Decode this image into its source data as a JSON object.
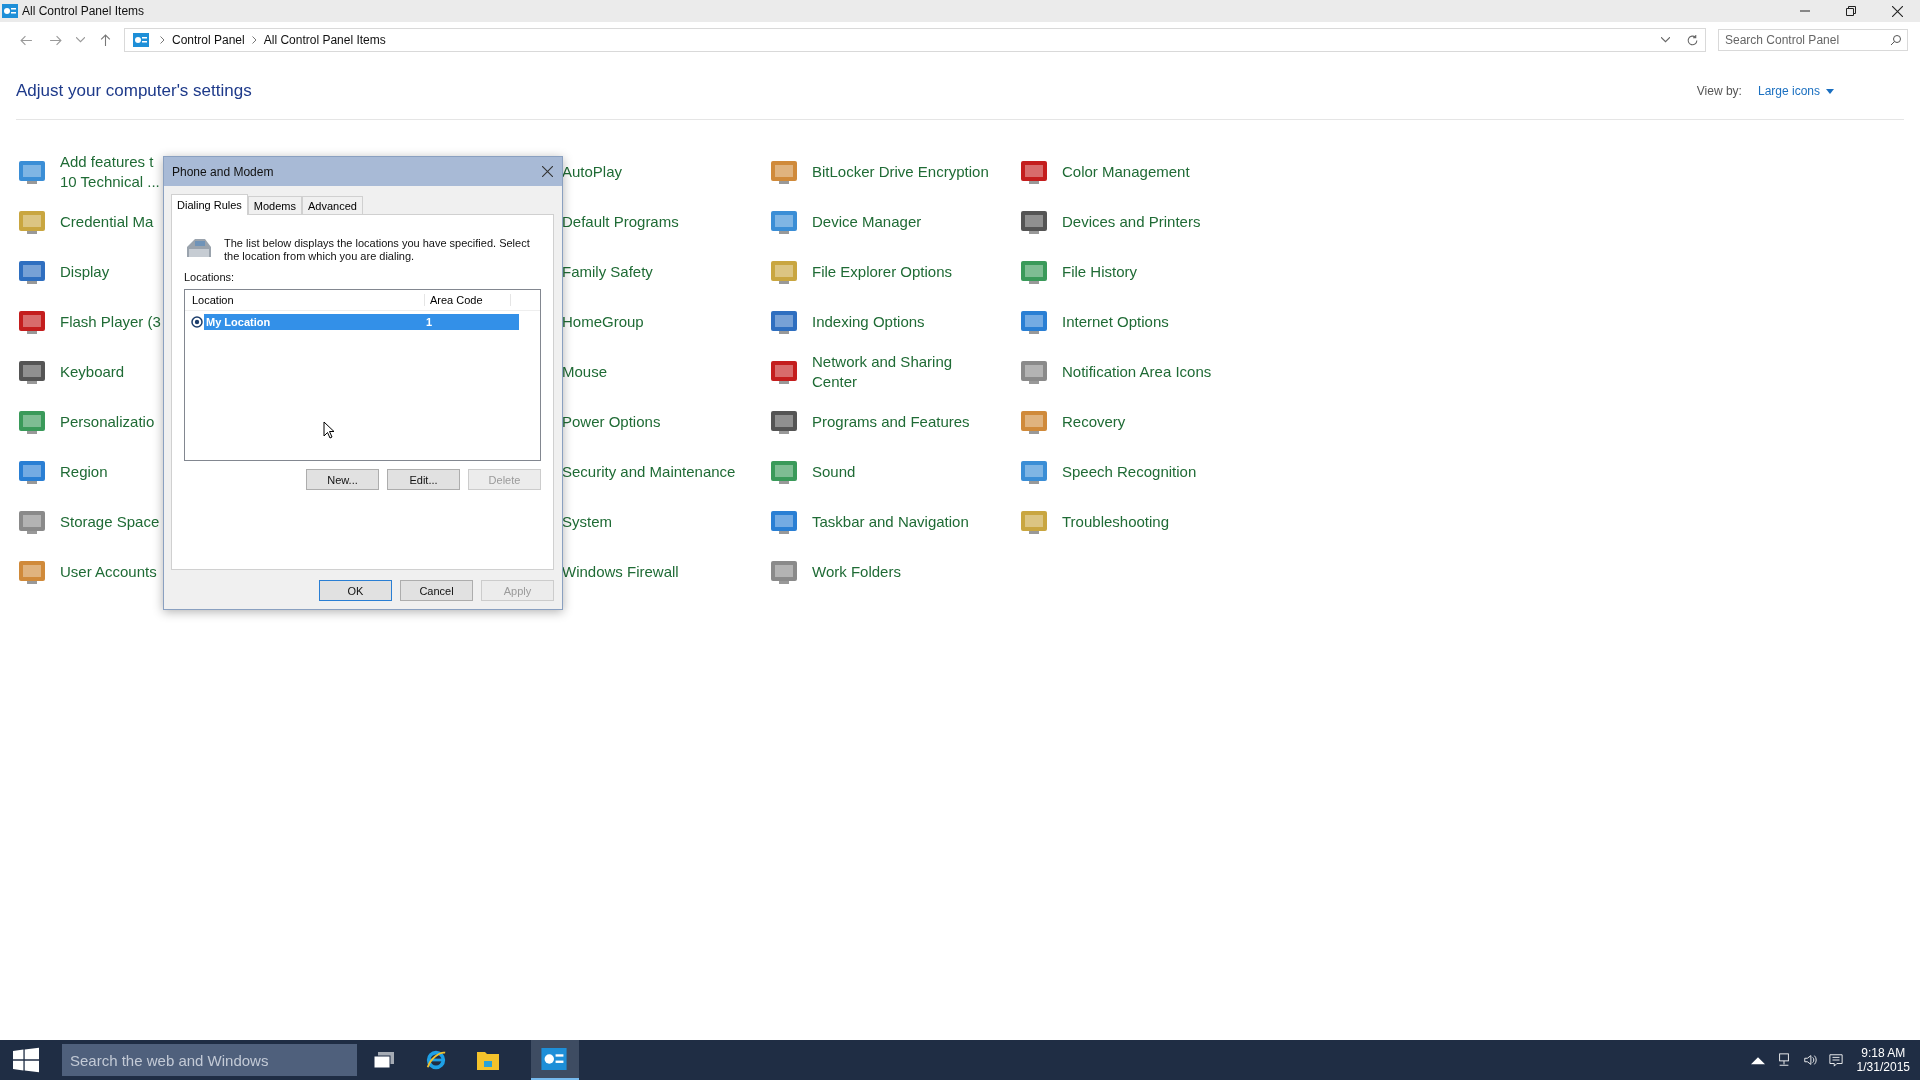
{
  "window": {
    "title": "All Control Panel Items"
  },
  "address_bar": {
    "path": [
      "Control Panel",
      "All Control Panel Items"
    ]
  },
  "search": {
    "placeholder": "Search Control Panel"
  },
  "heading": "Adjust your computer's settings",
  "view_by": {
    "label": "View by:",
    "value": "Large icons"
  },
  "columns": [
    [
      {
        "lines": [
          "Add features t",
          "10 Technical ..."
        ]
      },
      {
        "lines": [
          "Credential Ma"
        ]
      },
      {
        "lines": [
          "Display"
        ]
      },
      {
        "lines": [
          "Flash Player (3"
        ]
      },
      {
        "lines": [
          "Keyboard"
        ]
      },
      {
        "lines": [
          "Personalizatio"
        ]
      },
      {
        "lines": [
          "Region"
        ]
      },
      {
        "lines": [
          "Storage Space"
        ]
      },
      {
        "lines": [
          "User Accounts"
        ]
      }
    ],
    [
      {
        "lines": [
          "AutoPlay"
        ]
      },
      {
        "lines": [
          "Default Programs"
        ]
      },
      {
        "lines": [
          "Family Safety"
        ]
      },
      {
        "lines": [
          "HomeGroup"
        ]
      },
      {
        "lines": [
          "Mouse"
        ]
      },
      {
        "lines": [
          "Power Options"
        ]
      },
      {
        "lines": [
          "Security and Maintenance"
        ]
      },
      {
        "lines": [
          "System"
        ]
      },
      {
        "lines": [
          "Windows Firewall"
        ]
      }
    ],
    [
      {
        "lines": [
          "BitLocker Drive Encryption"
        ]
      },
      {
        "lines": [
          "Device Manager"
        ]
      },
      {
        "lines": [
          "File Explorer Options"
        ]
      },
      {
        "lines": [
          "Indexing Options"
        ]
      },
      {
        "lines": [
          "Network and Sharing",
          "Center"
        ]
      },
      {
        "lines": [
          "Programs and Features"
        ]
      },
      {
        "lines": [
          "Sound"
        ]
      },
      {
        "lines": [
          "Taskbar and Navigation"
        ]
      },
      {
        "lines": [
          "Work Folders"
        ]
      }
    ],
    [
      {
        "lines": [
          "Color Management"
        ]
      },
      {
        "lines": [
          "Devices and Printers"
        ]
      },
      {
        "lines": [
          "File History"
        ]
      },
      {
        "lines": [
          "Internet Options"
        ]
      },
      {
        "lines": [
          "Notification Area Icons"
        ]
      },
      {
        "lines": [
          "Recovery"
        ]
      },
      {
        "lines": [
          "Speech Recognition"
        ]
      },
      {
        "lines": [
          "Troubleshooting"
        ]
      }
    ]
  ],
  "dialog": {
    "title": "Phone and Modem",
    "tabs": [
      {
        "label": "Dialing Rules",
        "selected": true
      },
      {
        "label": "Modems",
        "selected": false
      },
      {
        "label": "Advanced",
        "selected": false
      }
    ],
    "description": "The list below displays the locations you have specified. Select the location from which you are dialing.",
    "list_label": "Locations:",
    "columns": [
      "Location",
      "Area Code"
    ],
    "rows": [
      {
        "location": "My Location",
        "area_code": "1",
        "selected": true
      }
    ],
    "list_buttons": [
      {
        "label": "New...",
        "disabled": false
      },
      {
        "label": "Edit...",
        "disabled": false
      },
      {
        "label": "Delete",
        "disabled": true
      }
    ],
    "buttons": [
      {
        "label": "OK",
        "disabled": false,
        "default": true
      },
      {
        "label": "Cancel",
        "disabled": false,
        "default": false
      },
      {
        "label": "Apply",
        "disabled": true,
        "default": false
      }
    ]
  },
  "taskbar": {
    "search_placeholder": "Search the web and Windows",
    "time": "9:18 AM",
    "date": "1/31/2015"
  }
}
